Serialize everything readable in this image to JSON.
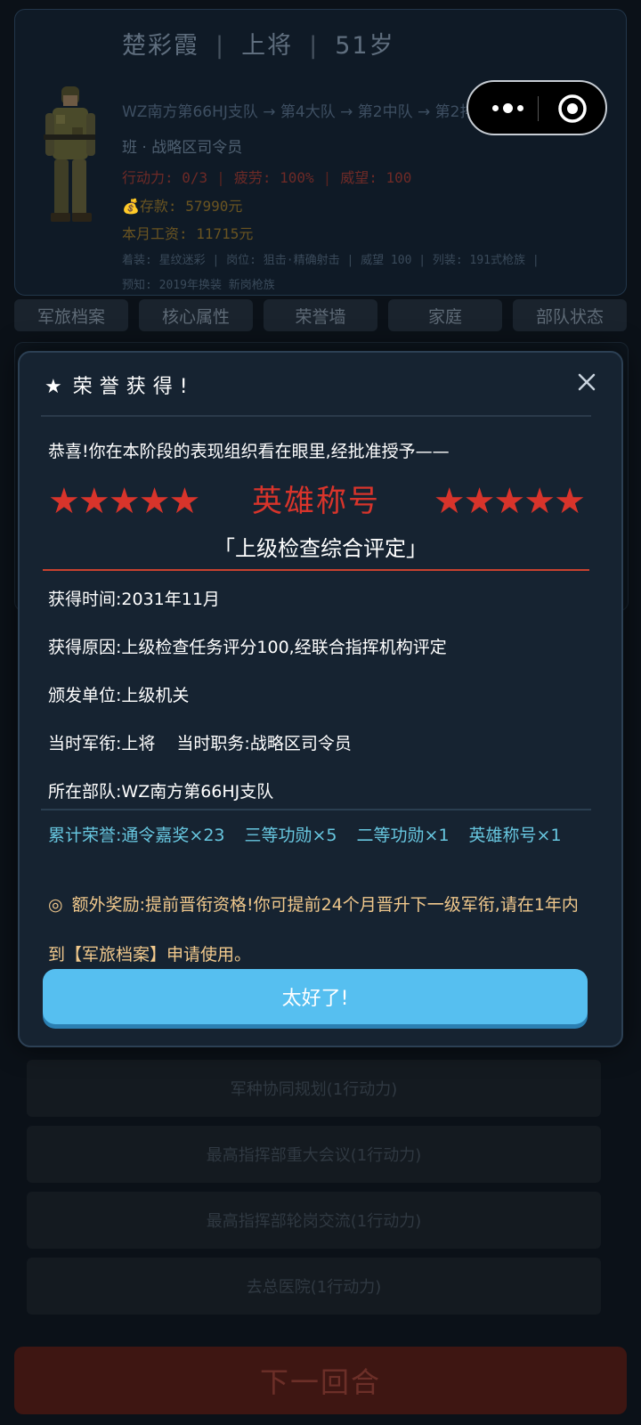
{
  "profile": {
    "name": "楚彩霞",
    "rank": "上将",
    "age": "51岁",
    "unit_path": "WZ南方第66HJ支队 → 第4大队 → 第2中队 → 第2排 → 第1",
    "unit_path_cont": "班 · 战略区司令员",
    "stats": {
      "action": "行动力: 0/3",
      "fatigue": "疲劳: 100%",
      "prestige": "威望: 100"
    },
    "savings": "💰存款: 57990元",
    "salary": "本月工资: 11715元",
    "equip_line1": "着装: 星纹迷彩 | 岗位: 狙击·精确射击 | 威望 100 | 列装: 191式枪族 |",
    "equip_line2": "预知: 2019年换装 新岗枪族"
  },
  "tabs": [
    "军旅档案",
    "核心属性",
    "荣誉墙",
    "家庭",
    "部队状态"
  ],
  "modal": {
    "title": "荣誉获得!",
    "title_star": "★",
    "congrats": "恭喜!你在本阶段的表现组织看在眼里,经批准授予——",
    "stars_left": "★★★★★",
    "hero_title": "英雄称号",
    "stars_right": "★★★★★",
    "evaluation": "「上级检查综合评定」",
    "info": {
      "time_label": "获得时间:",
      "time_value": "2031年11月",
      "reason_label": "获得原因:",
      "reason_value": "上级检查任务评分100,经联合指挥机构评定",
      "issuer_label": "颁发单位:",
      "issuer_value": "上级机关",
      "rank_label": "当时军衔:",
      "rank_value": "上将",
      "duty_label": "当时职务:",
      "duty_value": "战略区司令员",
      "unit_label": "所在部队:",
      "unit_value": "WZ南方第66HJ支队"
    },
    "honors_label": "累计荣誉:",
    "honors": [
      "通令嘉奖×23",
      "三等功勋×5",
      "二等功勋×1",
      "英雄称号×1"
    ],
    "extra_icon": "◎",
    "extra_reward": "额外奖励:提前晋衔资格!你可提前24个月晋升下一级军衔,请在1年内到【军旅档案】申请使用。",
    "ok_label": "太好了!"
  },
  "actions": [
    "军种协同规划(1行动力)",
    "最高指挥部重大会议(1行动力)",
    "最高指挥部轮岗交流(1行动力)",
    "去总医院(1行动力)"
  ],
  "next_turn": "下一回合",
  "capsule": {
    "more_icon": "more-dots-icon",
    "close_icon": "target-circle-icon"
  },
  "colors": {
    "background": "#0b1118",
    "modal_bg": "#162331",
    "hero_red": "#d8342b",
    "honor_cyan": "#67c6df",
    "reward_gold": "#f0c88c",
    "ok_button": "#56bff0"
  }
}
